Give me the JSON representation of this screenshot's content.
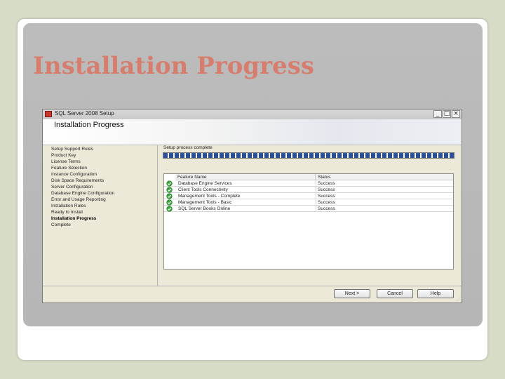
{
  "slide": {
    "title": "Installation Progress"
  },
  "window": {
    "title": "SQL Server 2008 Setup",
    "header_title": "Installation Progress",
    "controls": {
      "minimize": "_",
      "maximize": "□",
      "close": "×"
    }
  },
  "nav": {
    "items": [
      {
        "label": "Setup Support Rules",
        "active": false
      },
      {
        "label": "Product Key",
        "active": false
      },
      {
        "label": "License Terms",
        "active": false
      },
      {
        "label": "Feature Selection",
        "active": false
      },
      {
        "label": "Instance Configuration",
        "active": false
      },
      {
        "label": "Disk Space Requirements",
        "active": false
      },
      {
        "label": "Server Configuration",
        "active": false
      },
      {
        "label": "Database Engine Configuration",
        "active": false
      },
      {
        "label": "Error and Usage Reporting",
        "active": false
      },
      {
        "label": "Installation Rules",
        "active": false
      },
      {
        "label": "Ready to Install",
        "active": false
      },
      {
        "label": "Installation Progress",
        "active": true
      },
      {
        "label": "Complete",
        "active": false
      }
    ]
  },
  "progress": {
    "status_text": "Setup process complete",
    "percent": 100
  },
  "table": {
    "columns": [
      "Feature Name",
      "Status"
    ],
    "rows": [
      {
        "icon": "check-icon",
        "feature": "Database Engine Services",
        "status": "Success"
      },
      {
        "icon": "check-icon",
        "feature": "Client Tools Connectivity",
        "status": "Success"
      },
      {
        "icon": "check-icon",
        "feature": "Management Tools - Complete",
        "status": "Success"
      },
      {
        "icon": "check-icon",
        "feature": "Management Tools - Basic",
        "status": "Success"
      },
      {
        "icon": "check-icon",
        "feature": "SQL Server Books Online",
        "status": "Success"
      }
    ]
  },
  "buttons": {
    "next": "Next >",
    "cancel": "Cancel",
    "help": "Help"
  },
  "colors": {
    "title_accent": "#d67d6e",
    "progress_fill": "#2a4f9e",
    "success_icon": "#3aa43a"
  }
}
